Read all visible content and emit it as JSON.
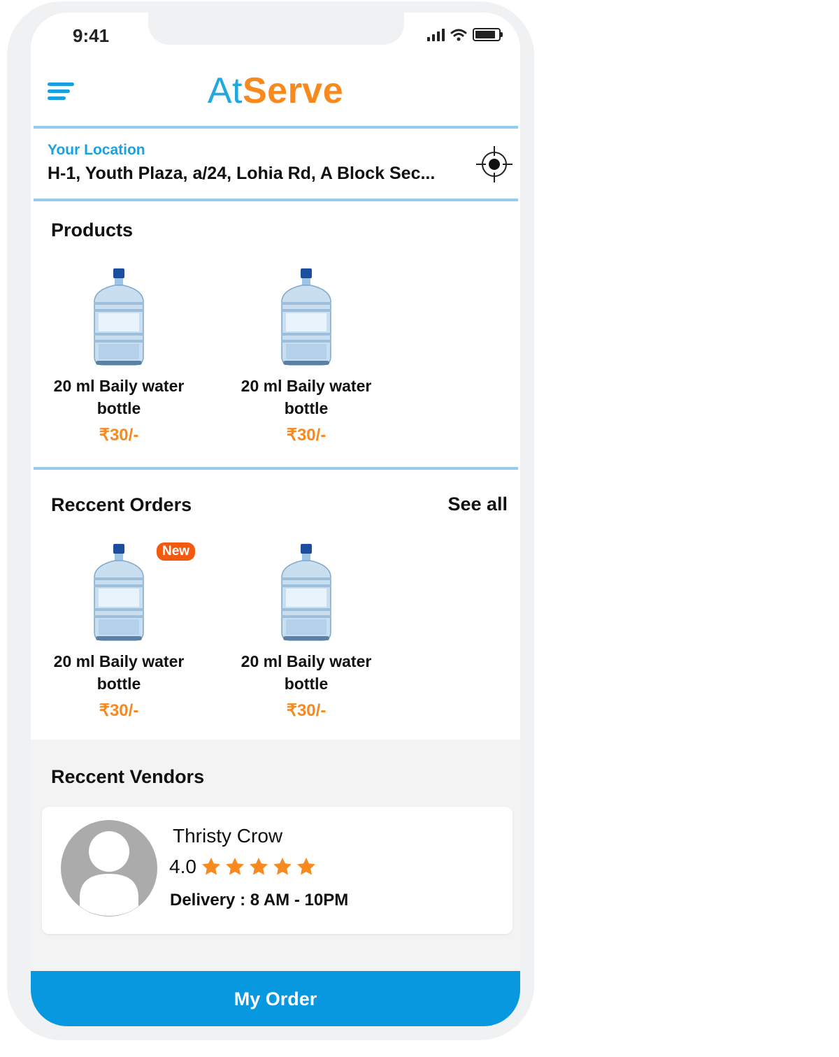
{
  "status": {
    "time": "9:41"
  },
  "header": {
    "logo_at": "At",
    "logo_serve": "Serve"
  },
  "location": {
    "label": "Your Location",
    "address": "H-1, Youth Plaza, a/24, Lohia Rd, A Block Sec..."
  },
  "products": {
    "title": "Products",
    "items": [
      {
        "name": "20 ml Baily water bottle",
        "price": "₹30/-"
      },
      {
        "name": "20 ml Baily water bottle",
        "price": "₹30/-"
      }
    ]
  },
  "recent_orders": {
    "title": "Reccent Orders",
    "see_all": "See all",
    "badge": "New",
    "items": [
      {
        "name": "20 ml Baily water bottle",
        "price": "₹30/-"
      },
      {
        "name": "20 ml Baily water bottle",
        "price": "₹30/-"
      }
    ]
  },
  "recent_vendors": {
    "title": "Reccent Vendors",
    "vendor": {
      "name": "Thristy Crow",
      "rating": "4.0",
      "stars": 5,
      "delivery": "Delivery : 8 AM - 10PM"
    }
  },
  "footer": {
    "button_label": "My Order"
  },
  "colors": {
    "accent_blue": "#0798df",
    "brand_orange": "#f7891f",
    "label_blue": "#1aa2de",
    "badge_orange": "#f25a0f"
  },
  "icons": [
    "menu-icon",
    "crosshair-icon",
    "star-icon",
    "avatar-icon",
    "water-bottle-icon"
  ]
}
